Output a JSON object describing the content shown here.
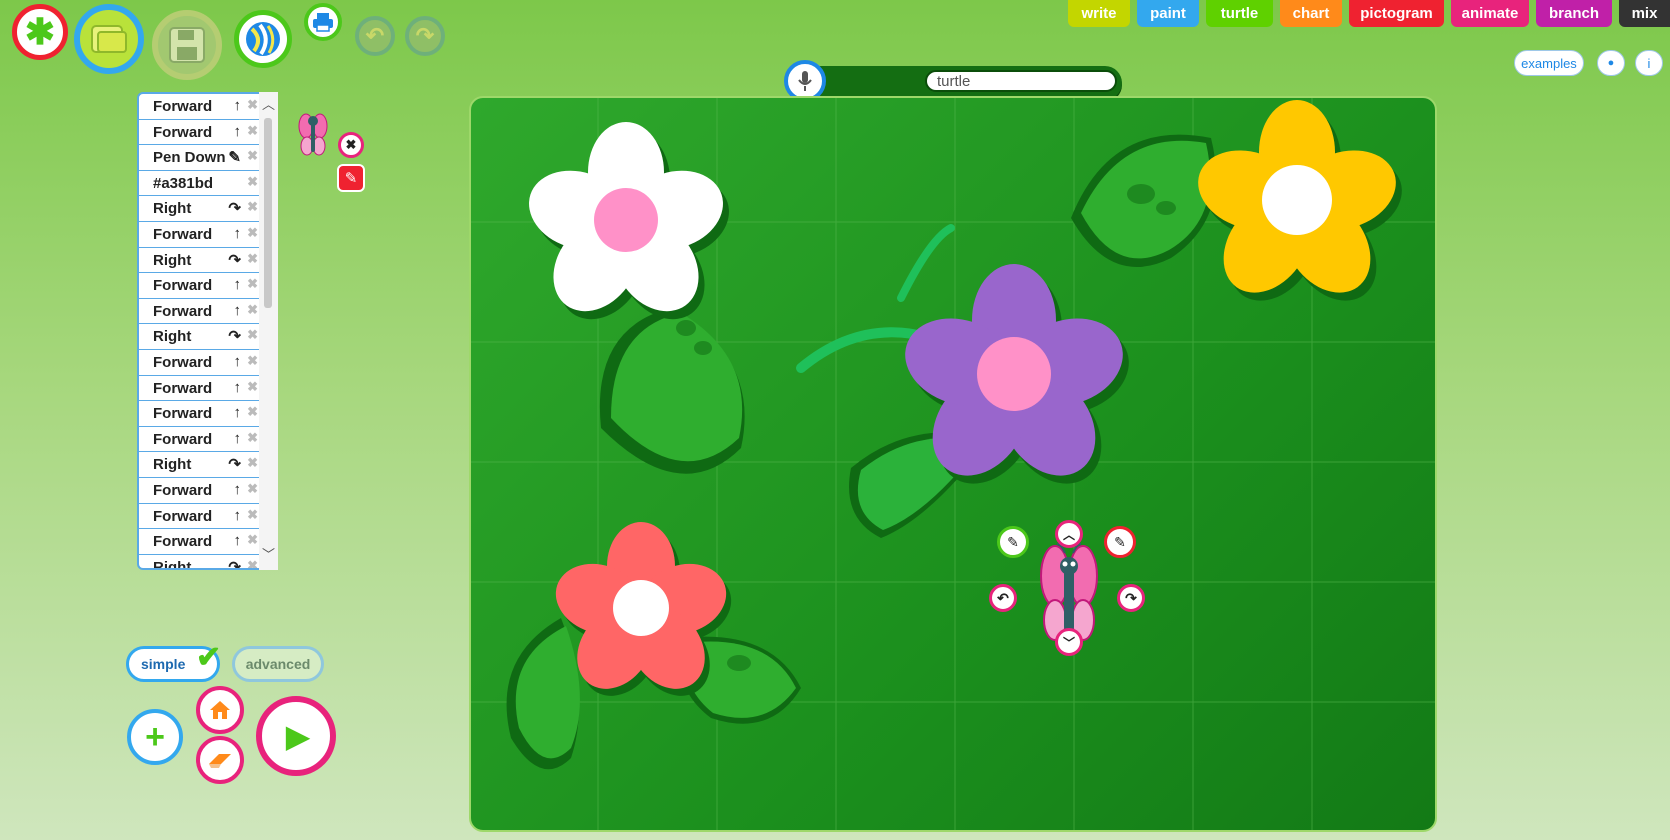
{
  "modes": {
    "write": {
      "label": "write",
      "color": "#c3d600"
    },
    "paint": {
      "label": "paint",
      "color": "#33a8ee"
    },
    "turtle": {
      "label": "turtle",
      "color": "#5fd100"
    },
    "chart": {
      "label": "chart",
      "color": "#ff8a1a"
    },
    "pictogram": {
      "label": "pictogram",
      "color": "#ef2230"
    },
    "animate": {
      "label": "animate",
      "color": "#e8237c"
    },
    "branch": {
      "label": "branch",
      "color": "#c020a8"
    },
    "mix": {
      "label": "mix",
      "color": "#333333"
    }
  },
  "header": {
    "examples_label": "examples",
    "info_label": "i",
    "person_icon": "person-icon"
  },
  "toolbar": {
    "icons": [
      "new-icon",
      "open-folder-icon",
      "save-icon",
      "share-icon",
      "print-icon",
      "undo-icon",
      "redo-icon"
    ]
  },
  "search": {
    "value": "turtle"
  },
  "commands": [
    {
      "label": "Forward",
      "icon": "↑"
    },
    {
      "label": "Forward",
      "icon": "↑"
    },
    {
      "label": "Pen Down",
      "icon": "✎"
    },
    {
      "label": "#a381bd",
      "icon": ""
    },
    {
      "label": "Right",
      "icon": "↷"
    },
    {
      "label": "Forward",
      "icon": "↑"
    },
    {
      "label": "Right",
      "icon": "↷"
    },
    {
      "label": "Forward",
      "icon": "↑"
    },
    {
      "label": "Forward",
      "icon": "↑"
    },
    {
      "label": "Right",
      "icon": "↷"
    },
    {
      "label": "Forward",
      "icon": "↑"
    },
    {
      "label": "Forward",
      "icon": "↑"
    },
    {
      "label": "Forward",
      "icon": "↑"
    },
    {
      "label": "Forward",
      "icon": "↑"
    },
    {
      "label": "Right",
      "icon": "↷"
    },
    {
      "label": "Forward",
      "icon": "↑"
    },
    {
      "label": "Forward",
      "icon": "↑"
    },
    {
      "label": "Forward",
      "icon": "↑"
    },
    {
      "label": "Right",
      "icon": "↷"
    }
  ],
  "mode_toggle": {
    "simple": "simple",
    "advanced": "advanced",
    "selected": "simple"
  },
  "colors": {
    "pen_color": "#a381bd",
    "accent_pink": "#e8237c",
    "canvas_green": "#1f9a22"
  }
}
